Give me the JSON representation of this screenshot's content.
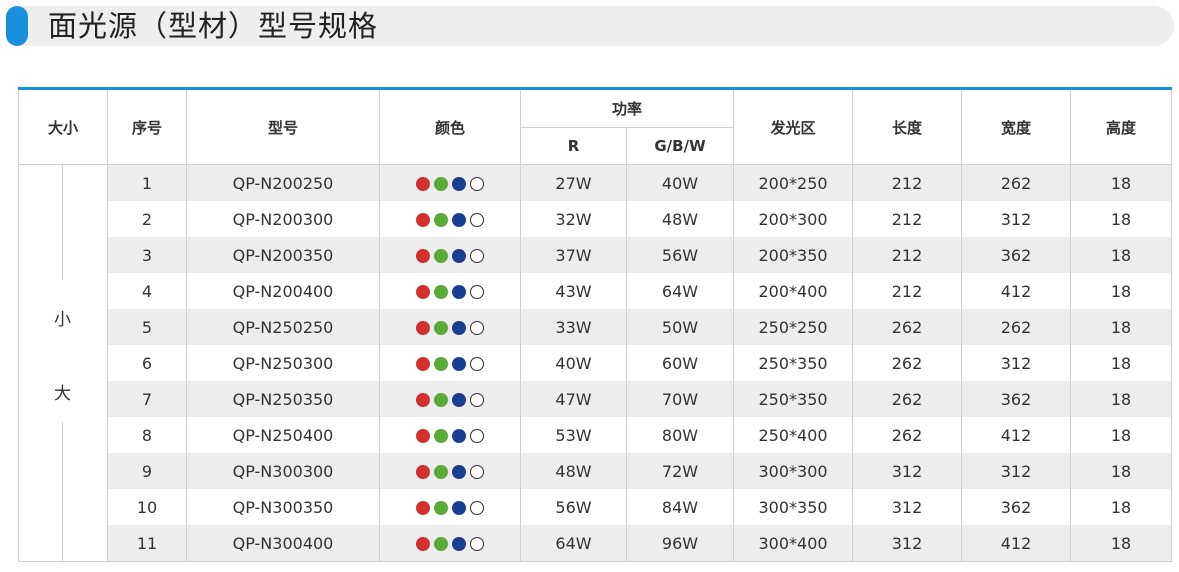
{
  "header": {
    "title": "面光源（型材）型号规格",
    "accent_color": "#1a8fdc"
  },
  "table": {
    "headers": {
      "size": "大小",
      "index": "序号",
      "model": "型号",
      "color": "颜色",
      "power": "功率",
      "power_r": "R",
      "power_gbw": "G/B/W",
      "emit_area": "发光区",
      "length": "长度",
      "width": "宽度",
      "height": "高度"
    },
    "size_labels": [
      "小",
      "大"
    ],
    "color_dots": [
      "#d0312d",
      "#5aaa3a",
      "#1a3f8f",
      "#ffffff"
    ],
    "rows": [
      {
        "index": "1",
        "model": "QP-N200250",
        "r": "27W",
        "gbw": "40W",
        "area": "200*250",
        "length": "212",
        "width": "262",
        "height": "18"
      },
      {
        "index": "2",
        "model": "QP-N200300",
        "r": "32W",
        "gbw": "48W",
        "area": "200*300",
        "length": "212",
        "width": "312",
        "height": "18"
      },
      {
        "index": "3",
        "model": "QP-N200350",
        "r": "37W",
        "gbw": "56W",
        "area": "200*350",
        "length": "212",
        "width": "362",
        "height": "18"
      },
      {
        "index": "4",
        "model": "QP-N200400",
        "r": "43W",
        "gbw": "64W",
        "area": "200*400",
        "length": "212",
        "width": "412",
        "height": "18"
      },
      {
        "index": "5",
        "model": "QP-N250250",
        "r": "33W",
        "gbw": "50W",
        "area": "250*250",
        "length": "262",
        "width": "262",
        "height": "18"
      },
      {
        "index": "6",
        "model": "QP-N250300",
        "r": "40W",
        "gbw": "60W",
        "area": "250*350",
        "length": "262",
        "width": "312",
        "height": "18"
      },
      {
        "index": "7",
        "model": "QP-N250350",
        "r": "47W",
        "gbw": "70W",
        "area": "250*350",
        "length": "262",
        "width": "362",
        "height": "18"
      },
      {
        "index": "8",
        "model": "QP-N250400",
        "r": "53W",
        "gbw": "80W",
        "area": "250*400",
        "length": "262",
        "width": "412",
        "height": "18"
      },
      {
        "index": "9",
        "model": "QP-N300300",
        "r": "48W",
        "gbw": "72W",
        "area": "300*300",
        "length": "312",
        "width": "312",
        "height": "18"
      },
      {
        "index": "10",
        "model": "QP-N300350",
        "r": "56W",
        "gbw": "84W",
        "area": "300*350",
        "length": "312",
        "width": "362",
        "height": "18"
      },
      {
        "index": "11",
        "model": "QP-N300400",
        "r": "64W",
        "gbw": "96W",
        "area": "300*400",
        "length": "312",
        "width": "412",
        "height": "18"
      }
    ]
  }
}
